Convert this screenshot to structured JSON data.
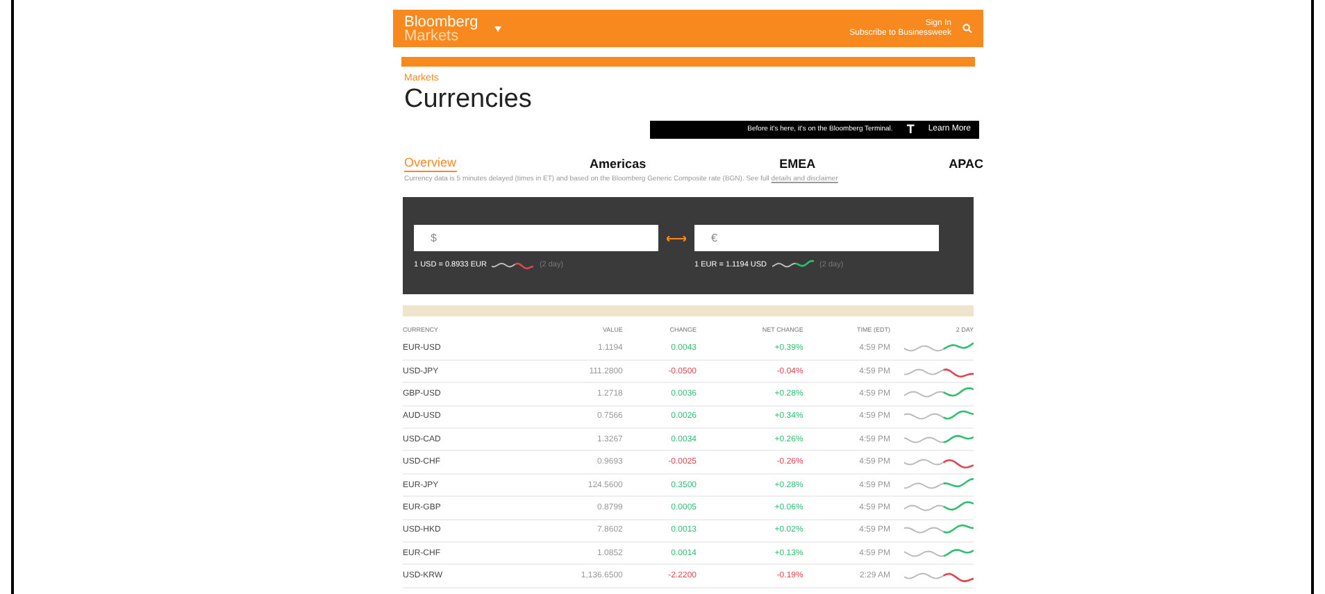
{
  "header": {
    "brand": "Bloomberg",
    "section": "Markets",
    "sign_in": "Sign In",
    "subscribe": "Subscribe to Businessweek"
  },
  "breadcrumb": "Markets",
  "title": "Currencies",
  "promo": {
    "text": "Before it's here, it's on the Bloomberg Terminal.",
    "logo": "T",
    "link": "Learn More"
  },
  "tabs": [
    {
      "label": "Overview",
      "selected": true
    },
    {
      "label": "Americas",
      "selected": false
    },
    {
      "label": "EMEA",
      "selected": false
    },
    {
      "label": "APAC",
      "selected": false
    }
  ],
  "disclaimer": "Currency data is 5 minutes delayed (times in ET) and based on the Bloomberg Generic Composite rate (BGN). See full",
  "disclaimer_link": "details and disclaimer",
  "converter": [
    {
      "symbol": "$",
      "rate": "1 USD = 0.8933 EUR",
      "range": "(2 day)",
      "kind": "down"
    },
    {
      "symbol": "€",
      "rate": "1 EUR = 1.1194 USD",
      "range": "(2 day)",
      "kind": "up"
    }
  ],
  "table": {
    "columns": [
      "CURRENCY",
      "VALUE",
      "CHANGE",
      "NET CHANGE",
      "TIME (EDT)",
      "2 DAY"
    ],
    "rows": [
      {
        "kind": "up",
        "cells": [
          "EUR-USD",
          "1.1194",
          "0.0043",
          "+0.39%",
          "4:59 PM"
        ]
      },
      {
        "kind": "down",
        "cells": [
          "USD-JPY",
          "111.2800",
          "-0.0500",
          "-0.04%",
          "4:59 PM"
        ]
      },
      {
        "kind": "up",
        "cells": [
          "GBP-USD",
          "1.2718",
          "0.0036",
          "+0.28%",
          "4:59 PM"
        ]
      },
      {
        "kind": "up",
        "cells": [
          "AUD-USD",
          "0.7566",
          "0.0026",
          "+0.34%",
          "4:59 PM"
        ]
      },
      {
        "kind": "up",
        "cells": [
          "USD-CAD",
          "1.3267",
          "0.0034",
          "+0.26%",
          "4:59 PM"
        ]
      },
      {
        "kind": "down",
        "cells": [
          "USD-CHF",
          "0.9693",
          "-0.0025",
          "-0.26%",
          "4:59 PM"
        ]
      },
      {
        "kind": "up",
        "cells": [
          "EUR-JPY",
          "124.5600",
          "0.3500",
          "+0.28%",
          "4:59 PM"
        ]
      },
      {
        "kind": "up",
        "cells": [
          "EUR-GBP",
          "0.8799",
          "0.0005",
          "+0.06%",
          "4:59 PM"
        ]
      },
      {
        "kind": "up",
        "cells": [
          "USD-HKD",
          "7.8602",
          "0.0013",
          "+0.02%",
          "4:59 PM"
        ]
      },
      {
        "kind": "up",
        "cells": [
          "EUR-CHF",
          "1.0852",
          "0.0014",
          "+0.13%",
          "4:59 PM"
        ]
      },
      {
        "kind": "down",
        "cells": [
          "USD-KRW",
          "1,136.6500",
          "-2.2200",
          "-0.19%",
          "2:29 AM"
        ]
      }
    ]
  }
}
